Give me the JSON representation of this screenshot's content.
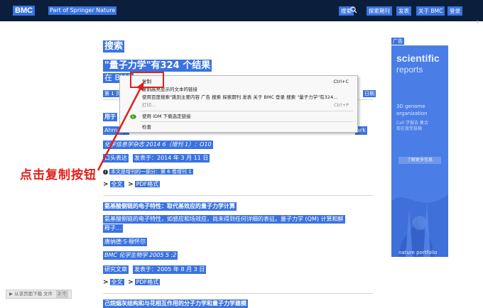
{
  "header": {
    "logo": "BMC",
    "tagline": "Part of Springer Nature",
    "nav": [
      "搜索",
      "探索期刊",
      "发表",
      "关于 BMC",
      "登录"
    ]
  },
  "page": {
    "heading": "搜索",
    "result_title": "\"量子力学\"有324 个结果",
    "in_label": "在 BMC",
    "page_info": "第 1 页, 共",
    "sort_label": "日期",
    "scroll_marker": "↑"
  },
  "results": [
    {
      "title": "用于",
      "authors": "Ahmed I",
      "authors_tail": "ark",
      "journal": "化学信息学杂志 2014 6（增刊 1）：O10",
      "type": "口头表达",
      "published": "发表于：2014 年 3 月 11 日",
      "supplement": "本文是增刊的一部分：第 6 卷增刊 1",
      "links": [
        "全文",
        "PDF格式"
      ]
    },
    {
      "title": "氨基酸侧链的电子特性：取代基效应的量子力学计算",
      "abstract_1": "氨基酸侧链的电子特性，如感应和场效应，尚未得到任何详细的表征。量子力学 (QM) 计算和解",
      "abstract_2": "释子...",
      "authors": "唐纳德·S·穆怀尔",
      "journal": "BMC 化学生物学 2005 5 :2",
      "type": "研究文章",
      "published": "发表于：2005 年 8 月 3 日",
      "links": [
        "全文",
        "PDF格式"
      ]
    },
    {
      "title": "己烷烟灰结构和与花相互作用的分子力学和量子力学建模"
    }
  ],
  "ad": {
    "label": "广告",
    "brand_1": "scientific",
    "brand_2": "reports",
    "line_1": "3D genome",
    "line_2": "organization",
    "line_3": "Cell 学报告 集合",
    "line_4": "现在接受投稿",
    "button": "了解更多信息",
    "footer": "nature portfolio"
  },
  "context_menu": {
    "items": [
      {
        "label": "复制",
        "shortcut": "Ctrl+C",
        "disabled": false
      },
      {
        "label": "复制高亮显示的文本的链接",
        "shortcut": "",
        "disabled": false
      },
      {
        "label": "使用百度搜索\"跳到主要内容 广告     搜索 探索期刊 发表 关于 BMC 登录 搜索 \"量子力学\"有324...",
        "shortcut": "",
        "disabled": false
      },
      {
        "label": "打印...",
        "shortcut": "Ctrl+P",
        "disabled": true
      },
      {
        "label": "使用 IDM 下载选定链接",
        "shortcut": "",
        "disabled": false
      },
      {
        "label": "检查",
        "shortcut": "",
        "disabled": false
      }
    ]
  },
  "annotation": {
    "text": "点击复制按钮",
    "color": "#e0201a"
  },
  "download_bar": {
    "label": "从该页面下载 文件",
    "count": "2",
    "unit": "个"
  },
  "colors": {
    "selection": "#3b73e0",
    "header_bg": "#0b1f3c",
    "annotation": "#e0201a"
  }
}
